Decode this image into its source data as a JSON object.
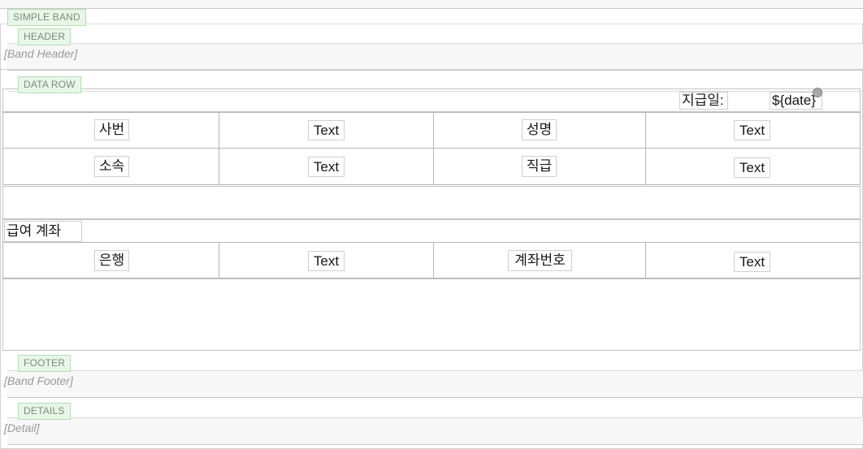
{
  "designer": {
    "bands": [
      {
        "id": "simple-band",
        "label": "SIMPLE BAND"
      },
      {
        "id": "header",
        "label": "HEADER"
      },
      {
        "id": "data-row",
        "label": "DATA ROW"
      },
      {
        "id": "footer",
        "label": "FOOTER"
      },
      {
        "id": "details",
        "label": "DETAILS"
      }
    ],
    "placeholders": {
      "band_header": "[Band Header]",
      "band_footer": "[Band Footer]",
      "detail": "[Detail]"
    },
    "colors": {
      "band_tab_bg": "#e8f6e8",
      "band_tab_border": "#b6dcb6",
      "band_tab_text": "#7d8a7d",
      "band_strip_bg": "#f7f7f7",
      "cell_border": "#b5b5b5",
      "element_outline": "#cfcfcf",
      "handle_fill": "#a9a9a9"
    }
  },
  "report": {
    "date_row": {
      "label": "지급일:",
      "value": "${date}"
    },
    "table": {
      "rows": [
        {
          "cells": [
            {
              "text": "사번",
              "kind": "label"
            },
            {
              "text": "Text",
              "kind": "field"
            },
            {
              "text": "성명",
              "kind": "label"
            },
            {
              "text": "Text",
              "kind": "field"
            }
          ]
        },
        {
          "cells": [
            {
              "text": "소속",
              "kind": "label"
            },
            {
              "text": "Text",
              "kind": "field"
            },
            {
              "text": "직급",
              "kind": "label"
            },
            {
              "text": "Text",
              "kind": "field"
            }
          ]
        }
      ]
    },
    "section": {
      "title": "급여 계좌",
      "rows": [
        {
          "cells": [
            {
              "text": "은행",
              "kind": "label"
            },
            {
              "text": "Text",
              "kind": "field"
            },
            {
              "text": "계좌번호",
              "kind": "label"
            },
            {
              "text": "Text",
              "kind": "field"
            }
          ]
        }
      ]
    }
  }
}
